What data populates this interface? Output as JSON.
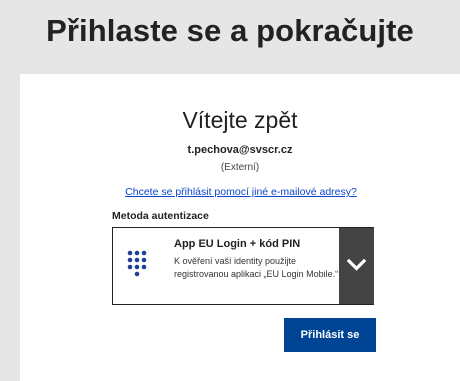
{
  "header": {
    "title": "Přihlaste se a pokračujte"
  },
  "login": {
    "welcome": "Vítejte zpět",
    "email": "t.pechova@svscr.cz",
    "account_type": "(Externí)",
    "other_email_link": "Chcete se přihlásit pomocí jiné e-mailové adresy?",
    "method_label": "Metoda autentizace",
    "selected_method": {
      "title": "App EU Login + kód PIN",
      "description": "K ověření vaší identity použijte registrovanou aplikaci „EU Login Mobile.“",
      "icon": "keypad-icon"
    },
    "dropdown_icon": "chevron-down-icon",
    "submit_label": "Přihlásit se"
  },
  "colors": {
    "header_bg": "#e6e6e6",
    "card_bg": "#ffffff",
    "link": "#0e47cb",
    "primary_button": "#004494",
    "icon_blue": "#1f3f97",
    "dropdown_bg": "#444444"
  }
}
